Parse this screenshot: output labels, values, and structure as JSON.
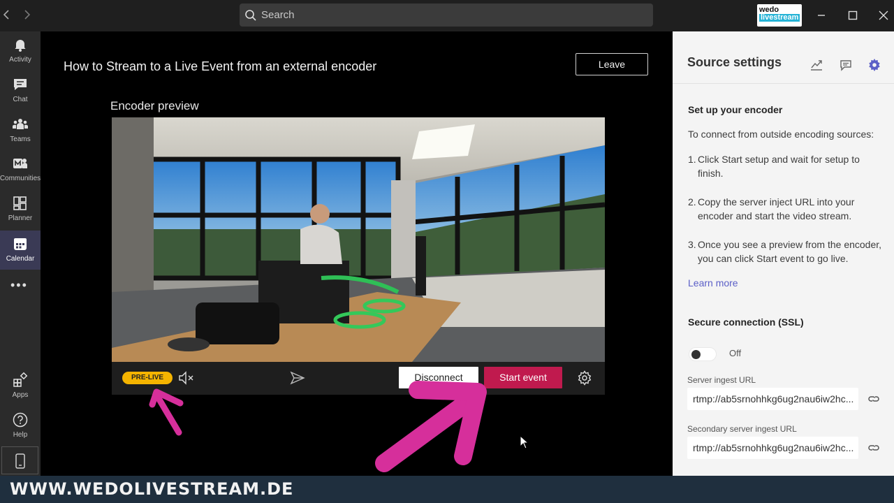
{
  "titlebar": {
    "search_placeholder": "Search",
    "avatar_line1": "wedo",
    "avatar_line2": "livestream"
  },
  "rail": {
    "items": [
      {
        "label": "Activity",
        "icon": "bell-icon"
      },
      {
        "label": "Chat",
        "icon": "chat-icon"
      },
      {
        "label": "Teams",
        "icon": "teams-icon"
      },
      {
        "label": "Communities",
        "icon": "communities-icon"
      },
      {
        "label": "Planner",
        "icon": "planner-icon"
      },
      {
        "label": "Calendar",
        "icon": "calendar-icon",
        "active": true
      },
      {
        "label": "Apps",
        "icon": "apps-icon"
      },
      {
        "label": "Help",
        "icon": "help-icon"
      }
    ],
    "more": "•••"
  },
  "main": {
    "event_title": "How to Stream to a Live Event from an external encoder",
    "leave_label": "Leave",
    "preview_label": "Encoder preview",
    "controls": {
      "status_badge": "PRE-LIVE",
      "disconnect_label": "Disconnect",
      "start_label": "Start event"
    }
  },
  "panel": {
    "title": "Source settings",
    "setup_title": "Set up your encoder",
    "intro": "To connect from outside encoding sources:",
    "steps": [
      {
        "num": "1.",
        "text": "Click Start setup and wait for setup to finish."
      },
      {
        "num": "2.",
        "text": "Copy the server inject URL into your encoder and start the video stream."
      },
      {
        "num": "3.",
        "text": "Once you see a preview from the encoder, you can click Start event to go live."
      }
    ],
    "learn_more": "Learn more",
    "ssl_title": "Secure connection (SSL)",
    "ssl_state": "Off",
    "ingest_label": "Server ingest URL",
    "ingest_value": "rtmp://ab5srnohhkg6ug2nau6iw2hc...",
    "secondary_label": "Secondary server ingest URL",
    "secondary_value": "rtmp://ab5srnohhkg6ug2nau6iw2hc..."
  },
  "footer": {
    "text": "WWW.WEDOLIVESTREAM.DE"
  },
  "colors": {
    "accent_start": "#c01a4e",
    "badge": "#f5b400",
    "annotation_arrow": "#d62f9b",
    "link": "#5b5fc7"
  }
}
